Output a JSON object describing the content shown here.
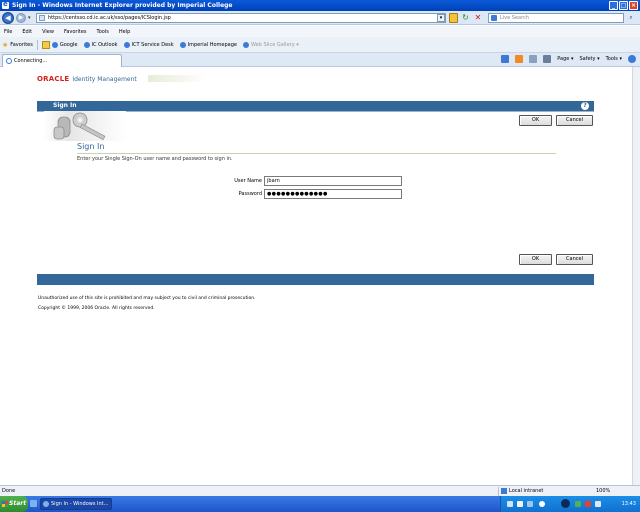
{
  "window": {
    "title": "Sign In - Windows Internet Explorer provided by Imperial College",
    "minimize": "_",
    "maximize": "□",
    "close": "×"
  },
  "address": {
    "url": "https://centsso.cd.ic.ac.uk/sso/pages/ICSlogin.jsp",
    "search_placeholder": "Live Search"
  },
  "menu": [
    "File",
    "Edit",
    "View",
    "Favorites",
    "Tools",
    "Help"
  ],
  "favorites": {
    "label": "Favorites",
    "items": [
      {
        "label": "Google",
        "disabled": false
      },
      {
        "label": "IC Outlook",
        "disabled": false
      },
      {
        "label": "ICT Service Desk",
        "disabled": false
      },
      {
        "label": "Imperial Homepage",
        "disabled": false
      },
      {
        "label": "Web Slice Gallery ▾",
        "disabled": true
      }
    ]
  },
  "tab": {
    "label": "Connecting..."
  },
  "commands": [
    "Page ▾",
    "Safety ▾",
    "Tools ▾"
  ],
  "page": {
    "oracle_brand": "ORACLE",
    "product": "Identity Management",
    "band_title": "Sign In",
    "ok_label": "OK",
    "cancel_label": "Cancel",
    "section_title": "Sign In",
    "instruction": "Enter your Single Sign-On user name and password to sign in.",
    "username_label": "User Name",
    "username_value": "jbarn",
    "password_label": "Password",
    "password_value": "●●●●●●●●●●●●●",
    "footer_note": "Unauthorized use of this site is prohibited and may subject you to civil and criminal prosecution.",
    "copyright": "Copyright © 1999, 2006 Oracle. All rights reserved."
  },
  "status": {
    "text": "Done",
    "zone": "Local intranet",
    "zoom": "100%"
  },
  "taskbar": {
    "start": "Start",
    "task": "Sign In - Windows Int...",
    "clock": "13:43"
  },
  "colors": {
    "oracle_red": "#d4201c",
    "band_blue": "#336699",
    "titlebar_blue": "#0a5ad8"
  }
}
